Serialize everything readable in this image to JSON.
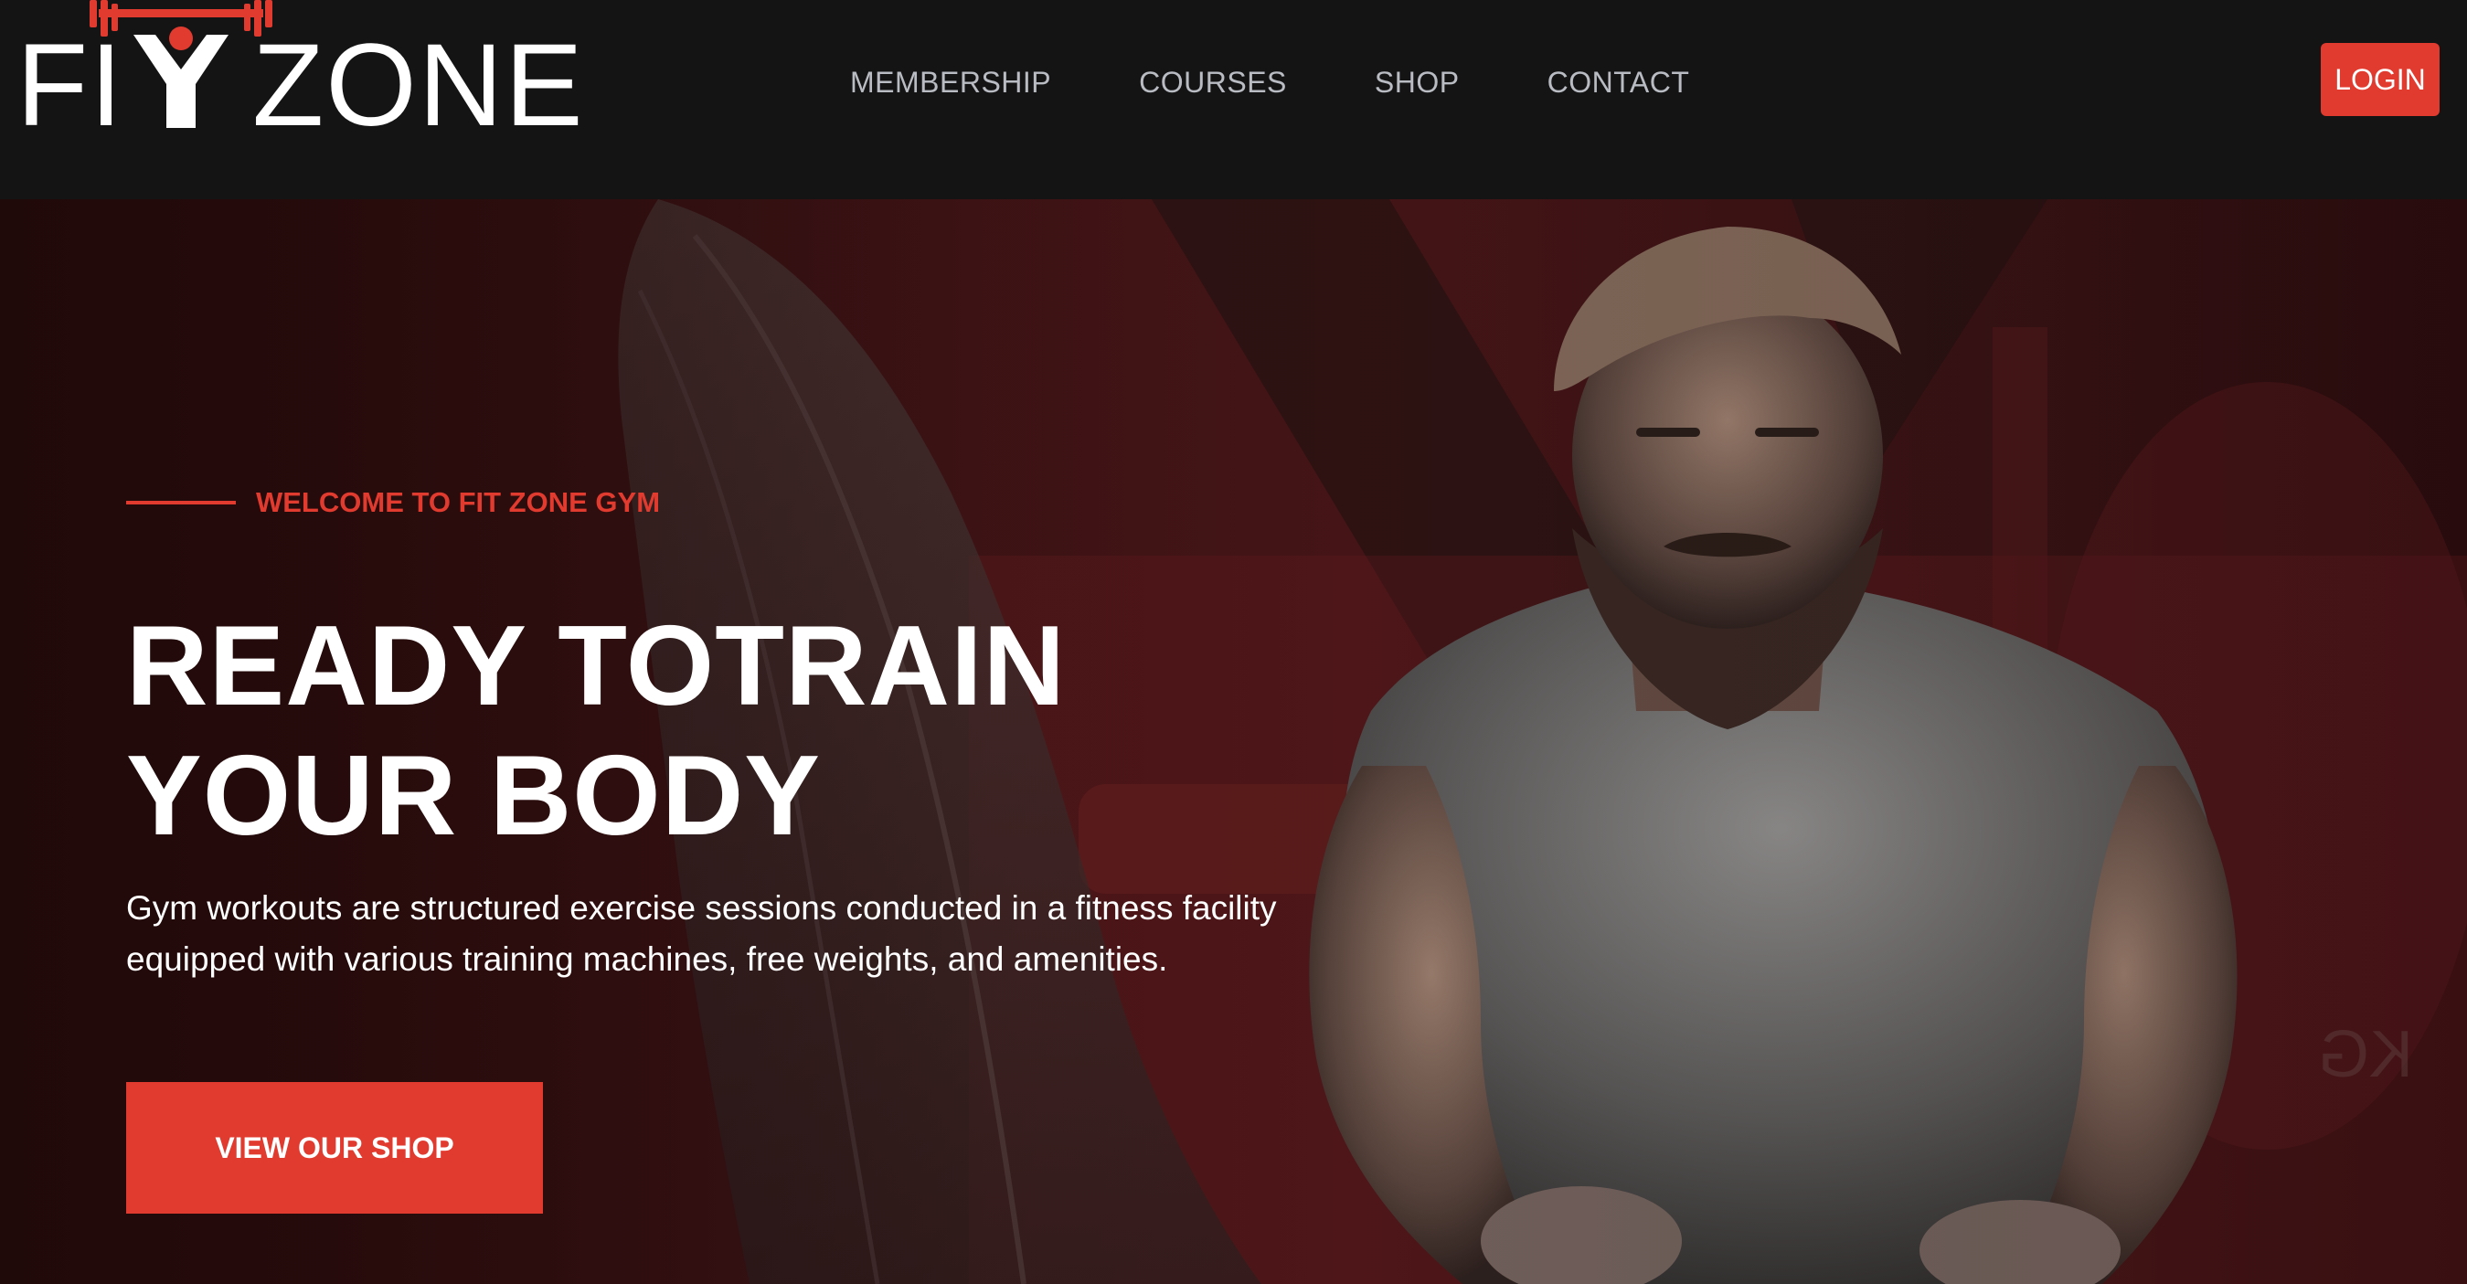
{
  "brand": {
    "logo_left": "FI",
    "logo_right": "ZONE",
    "accent_color": "#e13a2f"
  },
  "nav": {
    "links": [
      "MEMBERSHIP",
      "COURSES",
      "SHOP",
      "CONTACT"
    ],
    "login_label": "LOGIN"
  },
  "hero": {
    "eyebrow": "WELCOME TO FIT ZONE GYM",
    "headline_line1": "READY TOTRAIN",
    "headline_line2": "YOUR BODY",
    "description": "Gym workouts are structured exercise sessions conducted in a fitness facility equipped with various training machines, free weights, and amenities.",
    "cta_label": "VIEW OUR SHOP"
  },
  "icons": {
    "logo_mark": "barbell-lifter-icon"
  }
}
